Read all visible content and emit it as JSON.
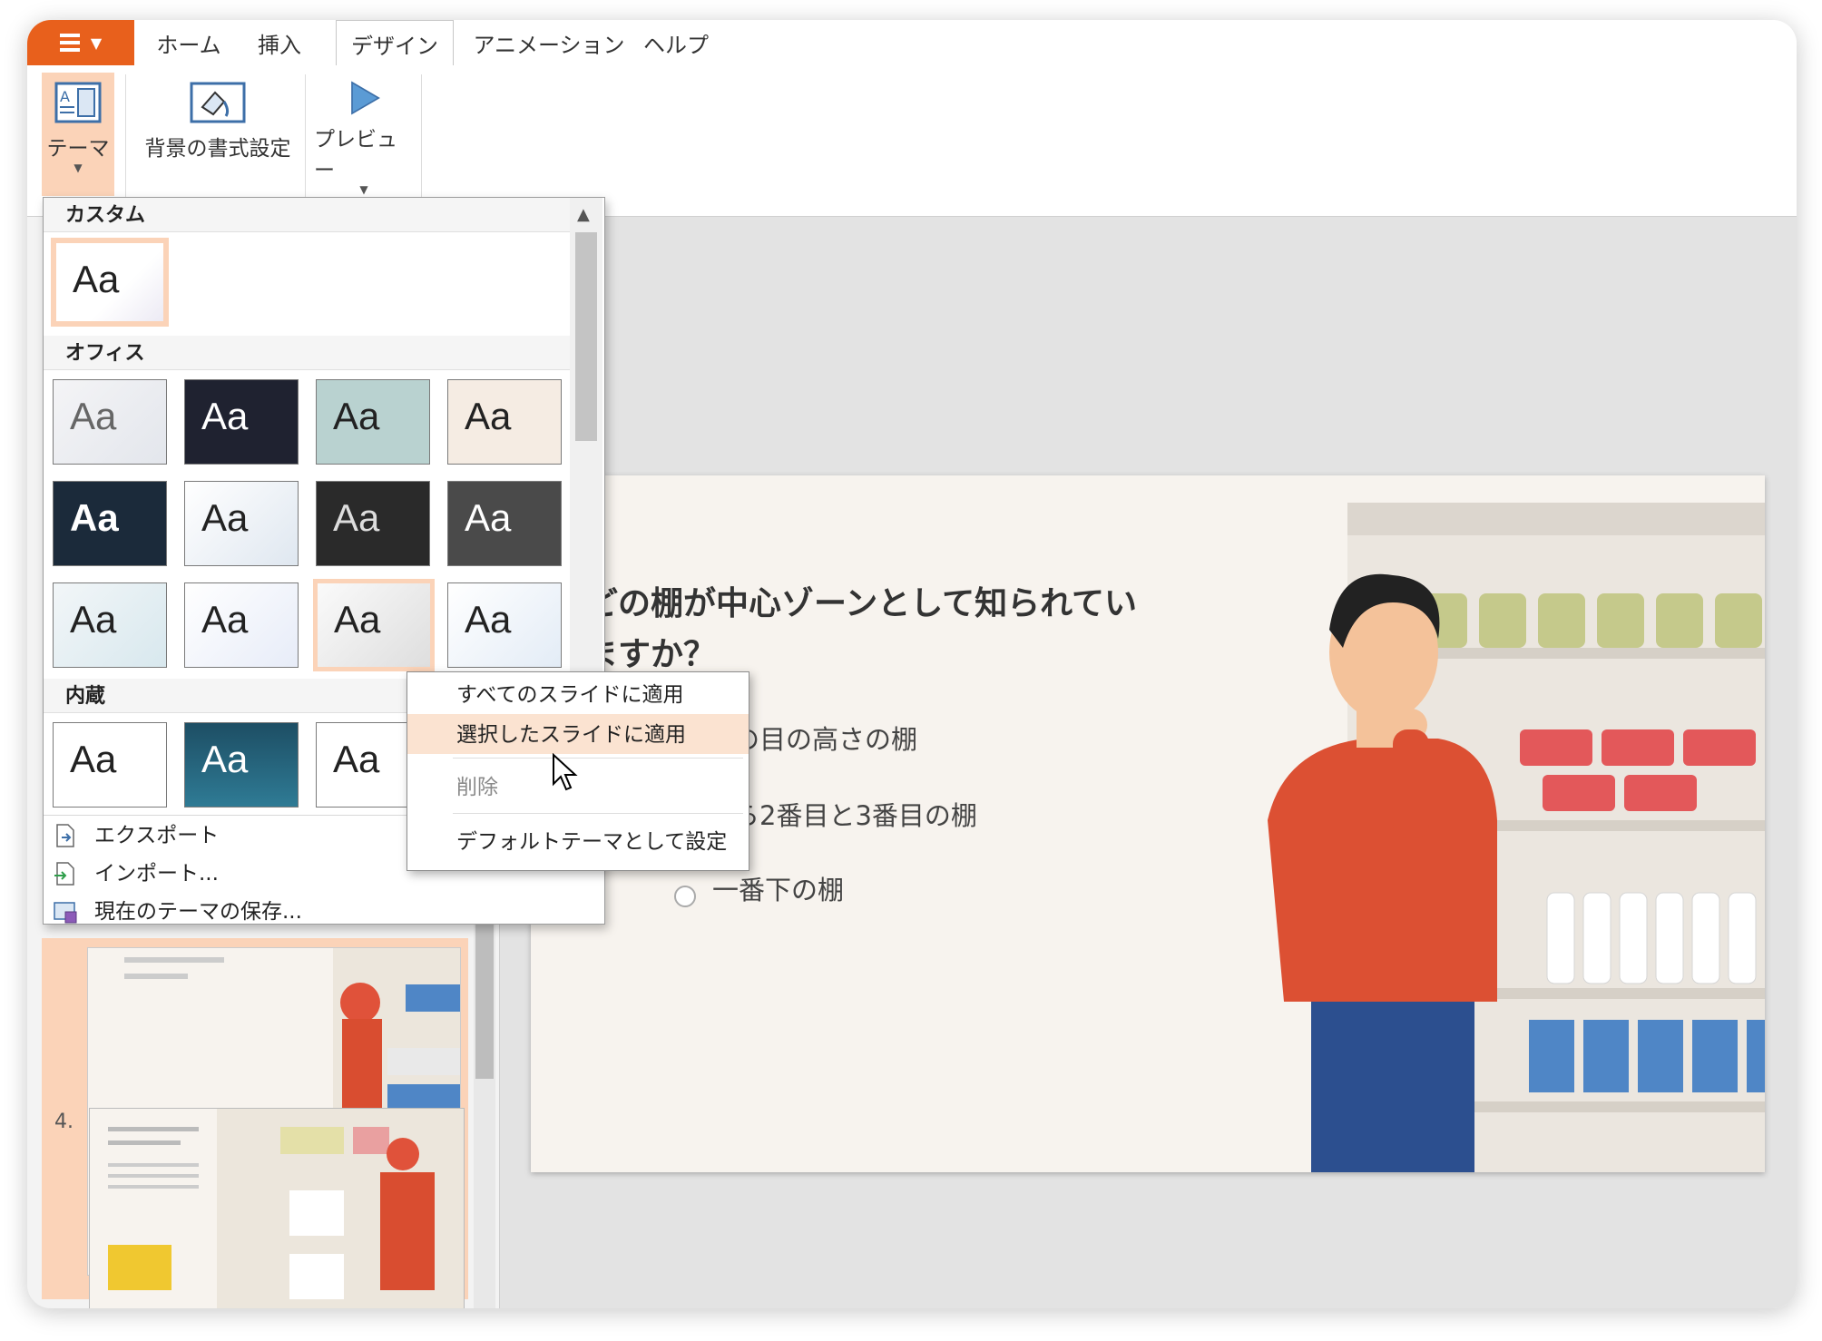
{
  "app_menu_label": "",
  "tabs": [
    "ホーム",
    "挿入",
    "デザイン",
    "アニメーション",
    "ヘルプ"
  ],
  "active_tab": "デザイン",
  "ribbon": {
    "theme_label": "テーマ",
    "background_label": "背景の書式設定",
    "preview_label": "プレビュー"
  },
  "theme_panel": {
    "sections": {
      "custom": "カスタム",
      "office": "オフィス",
      "builtin": "内蔵"
    },
    "tile_label": "Aa",
    "footer": {
      "export": "エクスポート",
      "import": "インポート...",
      "save": "現在のテーマの保存..."
    }
  },
  "context_menu": {
    "apply_all": "すべてのスライドに適用",
    "apply_selected": "選択したスライドに適用",
    "delete": "削除",
    "set_default": "デフォルトテーマとして設定"
  },
  "slide": {
    "question_line1": "どの棚が中心ゾーンとして知られてい",
    "question_line2": "ますか？",
    "option1": "子供の目の高さの棚",
    "option2": "上から2番目と3番目の棚",
    "option3": "一番下の棚"
  },
  "thumbnails": {
    "slide4_number": "4."
  },
  "colors": {
    "accent": "#e8601c",
    "selection": "#fbd3b8",
    "menu_highlight": "#fbe3d1"
  }
}
